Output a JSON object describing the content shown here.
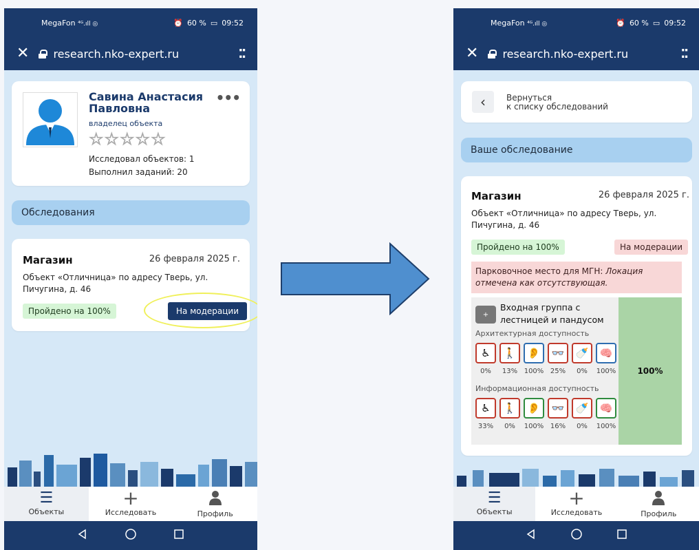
{
  "status": {
    "carrier": "MegaFon",
    "battery": "60 %",
    "time": "09:52"
  },
  "url": "research.nko-expert.ru",
  "profile": {
    "name": "Савина Анастасия Павловна",
    "role": "владелец объекта",
    "stars": "☆☆☆☆☆",
    "rating": 0,
    "explored": "Исследовал объектов: 1",
    "tasks": "Выполнил заданий: 20"
  },
  "section_surveys": "Обследования",
  "survey": {
    "title": "Магазин",
    "date": "26 февраля 2025 г.",
    "address": "Объект «Отличница» по адресу Тверь, ул. Пичугина, д. 46",
    "passed": "Пройдено на 100%",
    "moderation": "На модерации"
  },
  "detail": {
    "back_label_1": "Вернуться",
    "back_label_2": "к списку обследований",
    "section": "Ваше обследование",
    "alert_label": "Парковочное место для МГН:",
    "alert_text": "Локация отмечена как отсутствующая.",
    "group_title": "Входная группа с лестницей и пандусом",
    "group_plus": "+",
    "arch_label": "Архитектурная доступность",
    "info_label": "Информационная доступность",
    "arch_pcts": [
      "0%",
      "13%",
      "100%",
      "25%",
      "0%",
      "100%"
    ],
    "info_pcts": [
      "33%",
      "0%",
      "100%",
      "16%",
      "0%",
      "100%"
    ],
    "arch_colors": [
      "red",
      "red",
      "blue",
      "red",
      "red",
      "blue"
    ],
    "info_colors": [
      "red",
      "red",
      "green",
      "red",
      "red",
      "green"
    ],
    "group_total": "100%"
  },
  "nav": {
    "objects": "Объекты",
    "research": "Исследовать",
    "profile": "Профиль"
  },
  "colors": {
    "primary": "#1b3a6b",
    "section": "#a8d0f0",
    "passed_bg": "#d6f5d6",
    "mod_bg": "#f8d7d7",
    "highlight": "#f0f05a"
  }
}
